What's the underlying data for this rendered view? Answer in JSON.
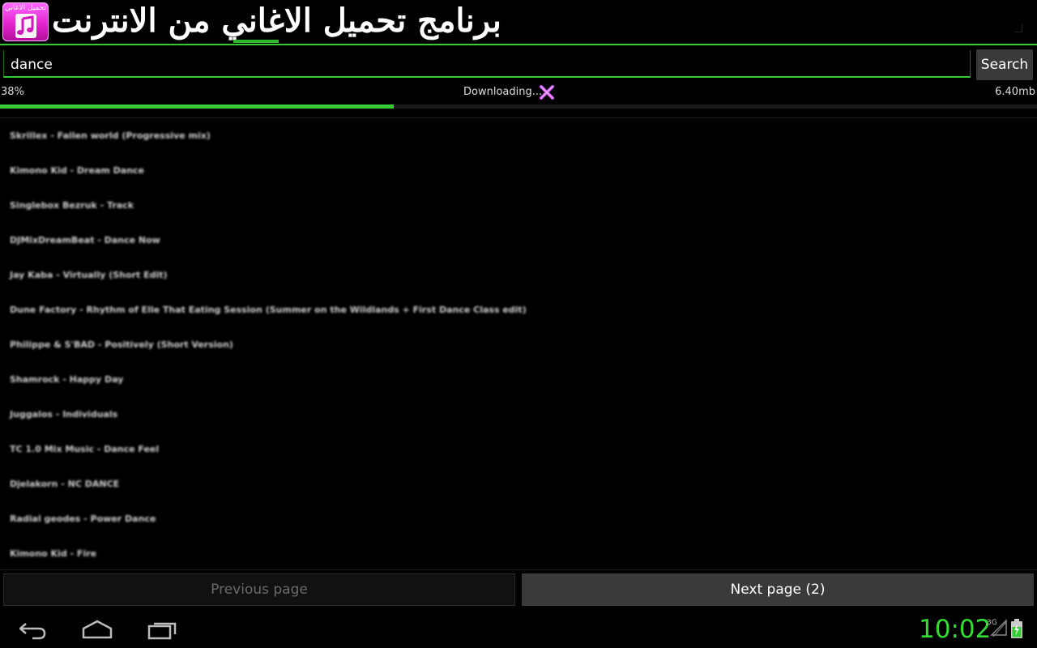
{
  "header": {
    "icon_label": "تحميل الاغاني",
    "icon": "music-note-icon",
    "title": "برنامج تحميل الاغاني من الانترنت",
    "accent_color": "#33cc33"
  },
  "search": {
    "value": "dance",
    "button_label": "Search"
  },
  "download": {
    "percent_label": "38%",
    "progress": 0.38,
    "status": "Downloading...",
    "size": "6.40mb",
    "cancel_icon": "close-icon"
  },
  "results": [
    "Skrillex - Fallen world (Progressive mix)",
    "Kimono Kid - Dream Dance",
    "Singlebox Bezruk - Track",
    "DJMixDreamBeat - Dance Now",
    "Jay Kaba - Virtually (Short Edit)",
    "Dune Factory - Rhythm of Elle That Eating Session (Summer on the Wildlands + First Dance Class edit)",
    "Philippe & S'BAD - Positively (Short Version)",
    "Shamrock - Happy Day",
    "Juggalos - Individuals",
    "TC 1.0 Mix Music - Dance Feel",
    "Djelakorn - NC DANCE",
    "Radial geodes - Power Dance",
    "Kimono Kid - Fire"
  ],
  "pager": {
    "prev_label": "Previous page",
    "next_label": "Next page (2)"
  },
  "system": {
    "time": "10:02",
    "network": "3G",
    "back_icon": "back-icon",
    "home_icon": "home-icon",
    "recents_icon": "recent-apps-icon"
  }
}
